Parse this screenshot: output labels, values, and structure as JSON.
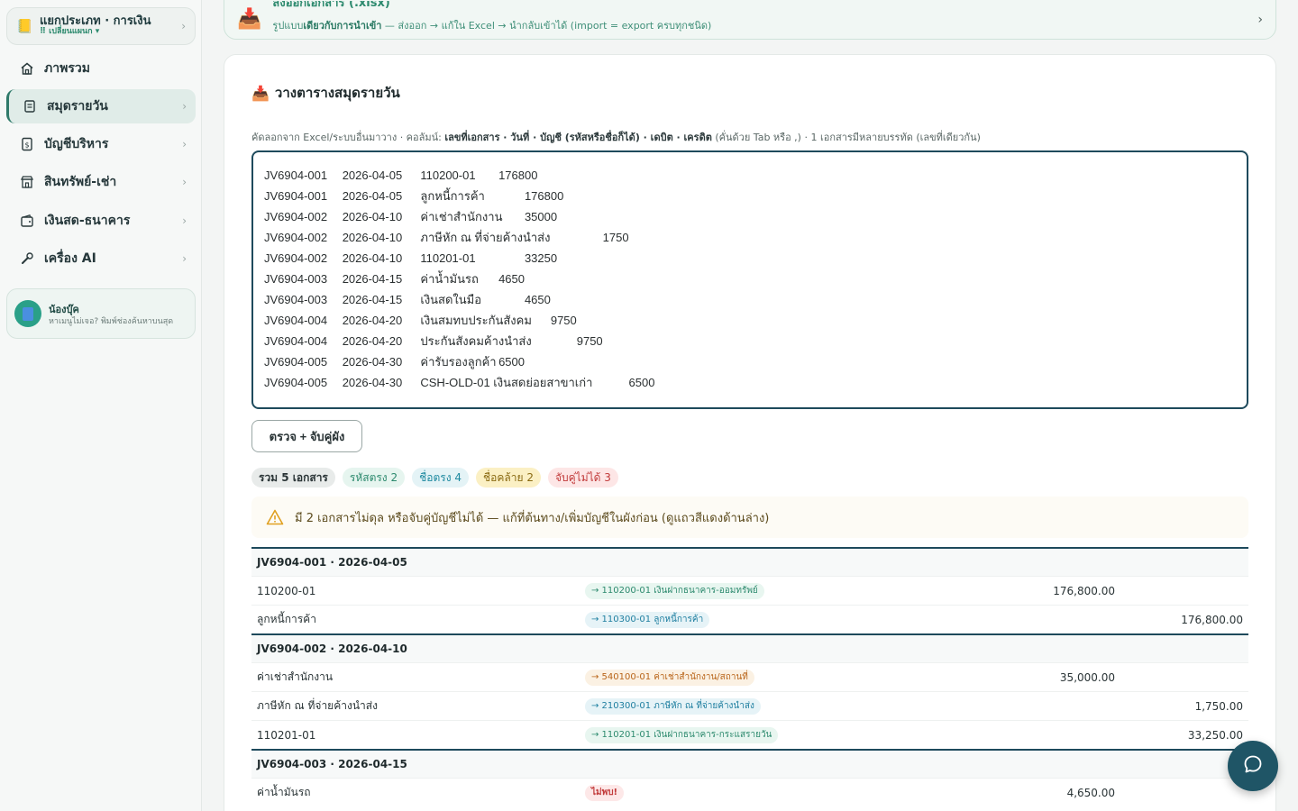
{
  "sidebar": {
    "workspace_title": "แยกประเภท · การเงิน",
    "workspace_sub": "⠿ เปลี่ยนแผนก ▾",
    "items": [
      {
        "label": "ภาพรวม",
        "icon": "home-icon"
      },
      {
        "label": "สมุดรายวัน",
        "icon": "journal-icon"
      },
      {
        "label": "บัญชีบริหาร",
        "icon": "ledger-icon"
      },
      {
        "label": "สินทรัพย์-เช่า",
        "icon": "building-icon"
      },
      {
        "label": "เงินสด-ธนาคาร",
        "icon": "wallet-icon"
      },
      {
        "label": "เครื่อง AI",
        "icon": "tools-icon"
      }
    ],
    "helper_name": "น้องบุ๊ค",
    "helper_text": "หาเมนูไม่เจอ? พิมพ์ช่องค้นหาบนสุด"
  },
  "export": {
    "title": "ส่งออกเอกสาร (.xlsx)",
    "sub_prefix": "รูปแบบ",
    "sub_bold": "เดียวกับการนำเข้า",
    "sub_rest": " — ส่งออก → แก้ใน Excel → นำกลับเข้าได้ (import = export ครบทุกชนิด)"
  },
  "card": {
    "title": "วางตารางสมุดรายวัน",
    "desc_prefix": "คัดลอกจาก Excel/ระบบอื่นมาวาง · คอลัมน์: ",
    "desc_bold": "เลขที่เอกสาร · วันที่ · บัญชี (รหัสหรือชื่อก็ได้) · เดบิต · เครดิต",
    "desc_rest": " (คั่นด้วย Tab หรือ ,) · 1 เอกสารมีหลายบรรทัด (เลขที่เดียวกัน)",
    "paste_value": "JV6904-001\t2026-04-05\t110200-01\t176800\nJV6904-001\t2026-04-05\tลูกหนี้การค้า\t\t176800\nJV6904-002\t2026-04-10\tค่าเช่าสำนักงาน\t35000\nJV6904-002\t2026-04-10\tภาษีหัก ณ ที่จ่ายค้างนำส่ง\t\t1750\nJV6904-002\t2026-04-10\t110201-01\t\t33250\nJV6904-003\t2026-04-15\tค่าน้ำมันรถ\t4650\nJV6904-003\t2026-04-15\tเงินสดในมือ\t\t4650\nJV6904-004\t2026-04-20\tเงินสมทบประกันสังคม\t9750\nJV6904-004\t2026-04-20\tประกันสังคมค้างนำส่ง\t\t9750\nJV6904-005\t2026-04-30\tค่ารับรองลูกค้า\t6500\nJV6904-005\t2026-04-30\tCSH-OLD-01 เงินสดย่อยสาขาเก่า\t\t6500",
    "check_button": "ตรวจ + จับคู่ผัง",
    "chips": {
      "total": "รวม 5 เอกสาร",
      "code_match": "รหัสตรง 2",
      "name_match": "ชื่อตรง 4",
      "fuzzy": "ชื่อคล้าย 2",
      "no_match": "จับคู่ไม่ได้ 3"
    },
    "warning": "มี 2 เอกสารไม่ดุล หรือจับคู่บัญชีไม่ได้ — แก้ที่ต้นทาง/เพิ่มบัญชีในผังก่อน (ดูแถวสีแดงด้านล่าง)"
  },
  "groups": [
    {
      "header": "JV6904-001 · 2026-04-05",
      "rows": [
        {
          "input": "110200-01",
          "map": "→ 110200-01 เงินฝากธนาคาร-ออมทรัพย์",
          "status": "code",
          "debit": "176,800.00",
          "credit": ""
        },
        {
          "input": "ลูกหนี้การค้า",
          "map": "→ 110300-01 ลูกหนี้การค้า",
          "status": "name",
          "debit": "",
          "credit": "176,800.00"
        }
      ]
    },
    {
      "header": "JV6904-002 · 2026-04-10",
      "rows": [
        {
          "input": "ค่าเช่าสำนักงาน",
          "map": "→ 540100-01 ค่าเช่าสำนักงาน/สถานที่",
          "status": "fuzzy",
          "debit": "35,000.00",
          "credit": ""
        },
        {
          "input": "ภาษีหัก ณ ที่จ่ายค้างนำส่ง",
          "map": "→ 210300-01 ภาษีหัก ณ ที่จ่ายค้างนำส่ง",
          "status": "name",
          "debit": "",
          "credit": "1,750.00"
        },
        {
          "input": "110201-01",
          "map": "→ 110201-01 เงินฝากธนาคาร-กระแสรายวัน",
          "status": "code",
          "debit": "",
          "credit": "33,250.00"
        }
      ]
    },
    {
      "header": "JV6904-003 · 2026-04-15",
      "rows": [
        {
          "input": "ค่าน้ำมันรถ",
          "map": "ไม่พบ!",
          "status": "bad",
          "debit": "4,650.00",
          "credit": ""
        }
      ]
    }
  ],
  "colors": {
    "accent": "#1e4a5c",
    "green": "#2d8a6e",
    "red": "#c23b3b",
    "fab": "#1f5566"
  }
}
